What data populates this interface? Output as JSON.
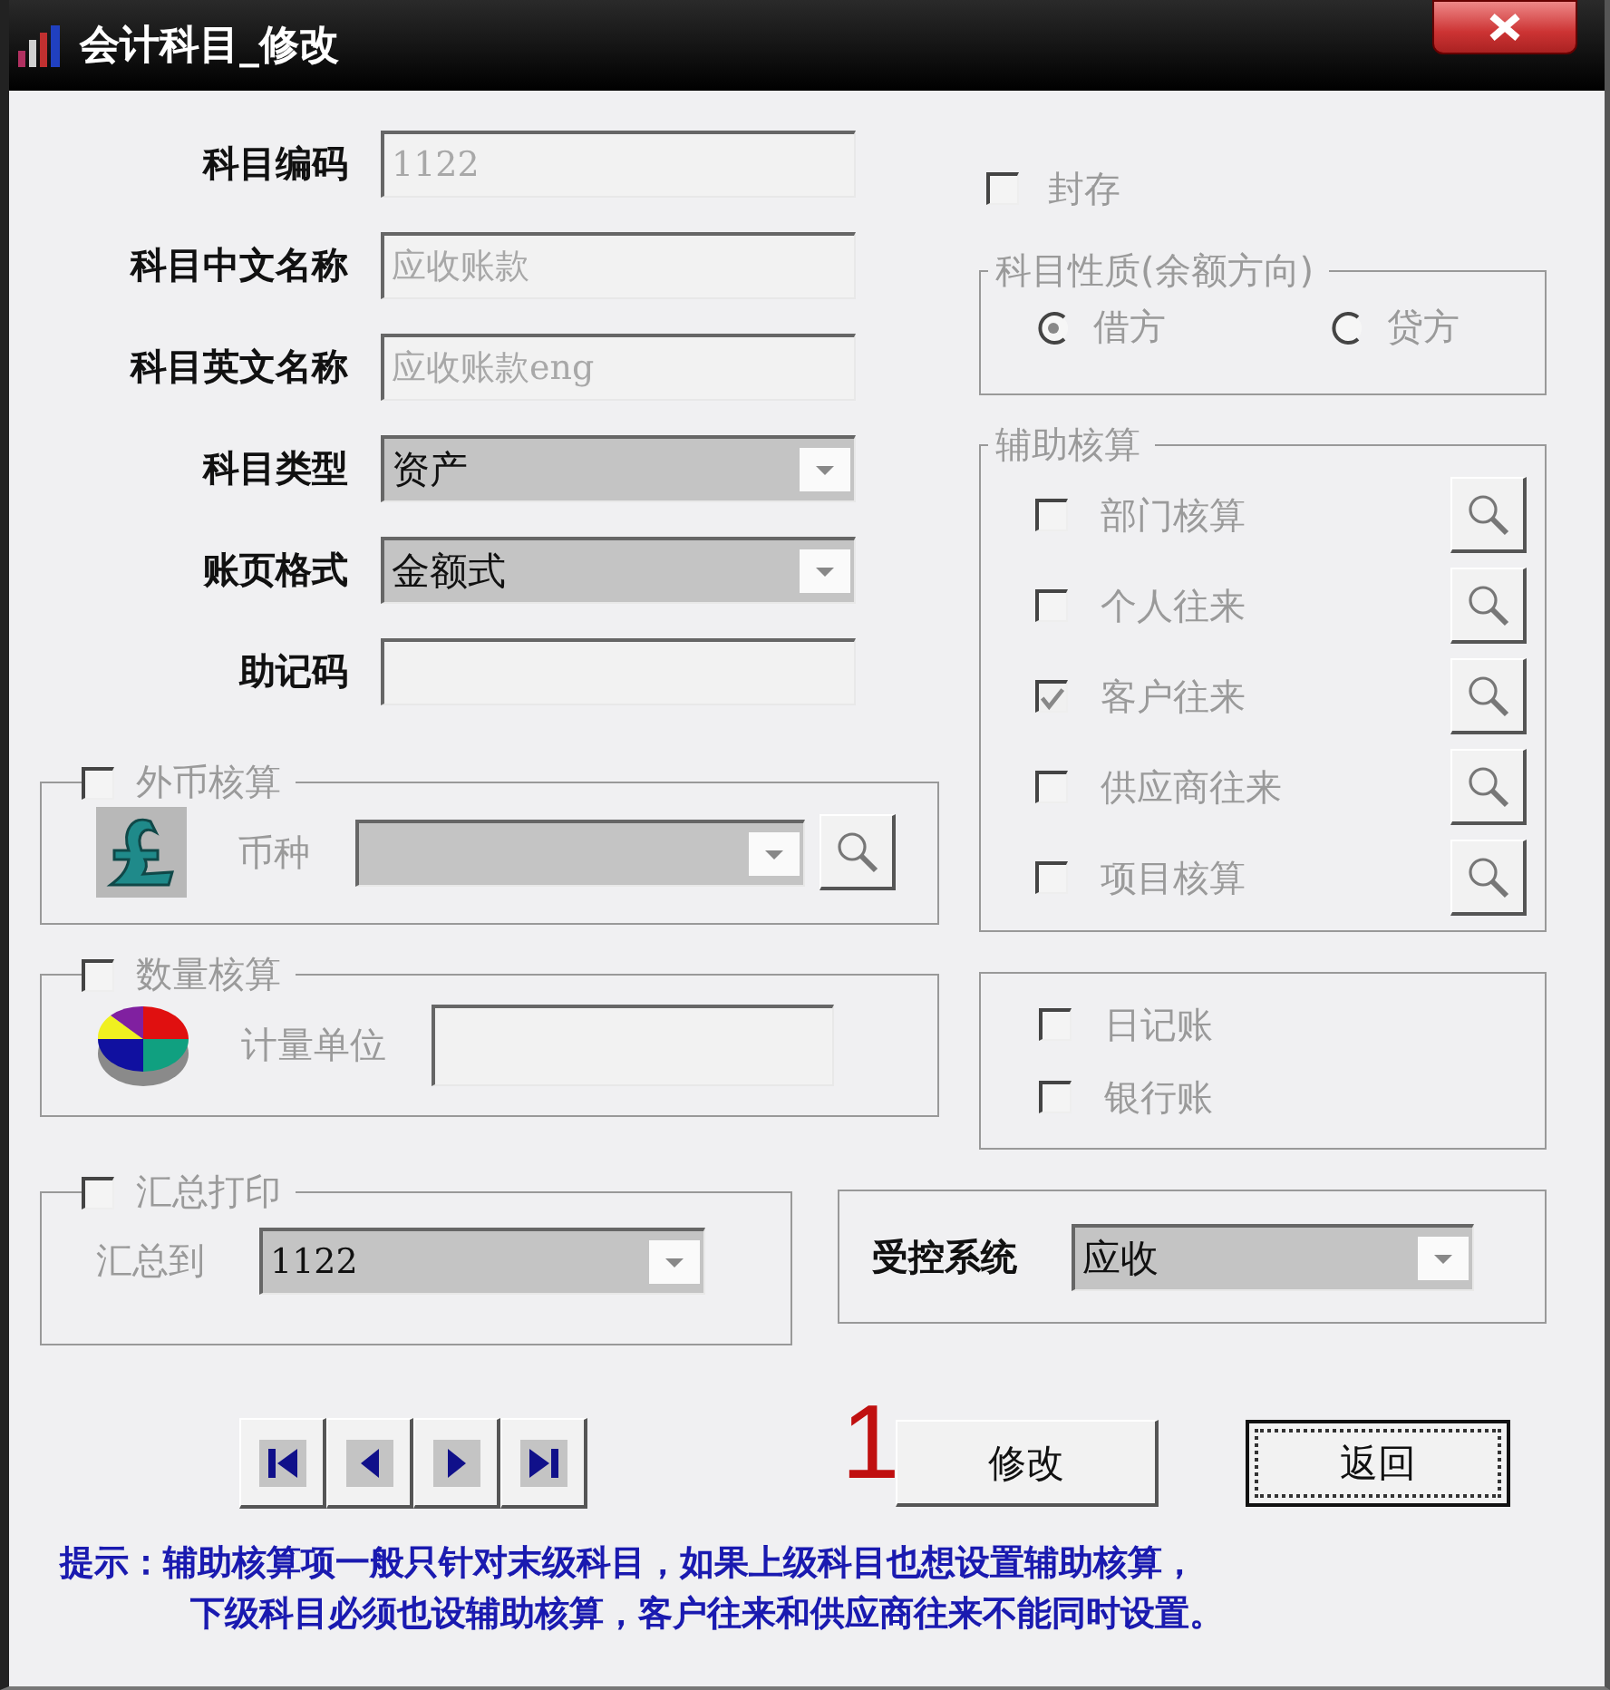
{
  "window": {
    "title": "会计科目_修改"
  },
  "fields": [
    {
      "label": "科目编码",
      "kind": "text",
      "value": "1122",
      "disabled": true
    },
    {
      "label": "科目中文名称",
      "kind": "text",
      "value": "应收账款",
      "disabled": true
    },
    {
      "label": "科目英文名称",
      "kind": "text",
      "value": "应收账款eng",
      "disabled": true
    },
    {
      "label": "科目类型",
      "kind": "dropdown",
      "value": "资产"
    },
    {
      "label": "账页格式",
      "kind": "dropdown",
      "value": "金额式"
    },
    {
      "label": "助记码",
      "kind": "text"
    }
  ],
  "foreign_currency": {
    "label": "外币核算",
    "checked": false,
    "field_label": "币种"
  },
  "quantity": {
    "label": "数量核算",
    "checked": false,
    "field_label": "计量单位"
  },
  "sealed": {
    "label": "封存",
    "checked": false
  },
  "balance_direction": {
    "title": "科目性质(余额方向)",
    "options": [
      {
        "label": "借方",
        "selected": true
      },
      {
        "label": "贷方",
        "selected": false
      }
    ]
  },
  "auxiliary": {
    "title": "辅助核算",
    "items": [
      {
        "label": "部门核算",
        "checked": false
      },
      {
        "label": "个人往来",
        "checked": false
      },
      {
        "label": "客户往来",
        "checked": true
      },
      {
        "label": "供应商往来",
        "checked": false
      },
      {
        "label": "项目核算",
        "checked": false
      }
    ]
  },
  "journals": [
    {
      "label": "日记账",
      "checked": false
    },
    {
      "label": "银行账",
      "checked": false
    }
  ],
  "summary_print": {
    "label": "汇总打印",
    "checked": false,
    "field_label": "汇总到",
    "value": "1122"
  },
  "controlled_system": {
    "label": "受控系统",
    "value": "应收"
  },
  "annotation": "1",
  "buttons": [
    {
      "label": "修改",
      "focused": false
    },
    {
      "label": "返回",
      "focused": true
    }
  ],
  "hint": [
    "提示：辅助核算项一般只针对末级科目，如果上级科目也想设置辅助核算，",
    "下级科目必须也设辅助核算，客户往来和供应商往来不能同时设置。"
  ]
}
